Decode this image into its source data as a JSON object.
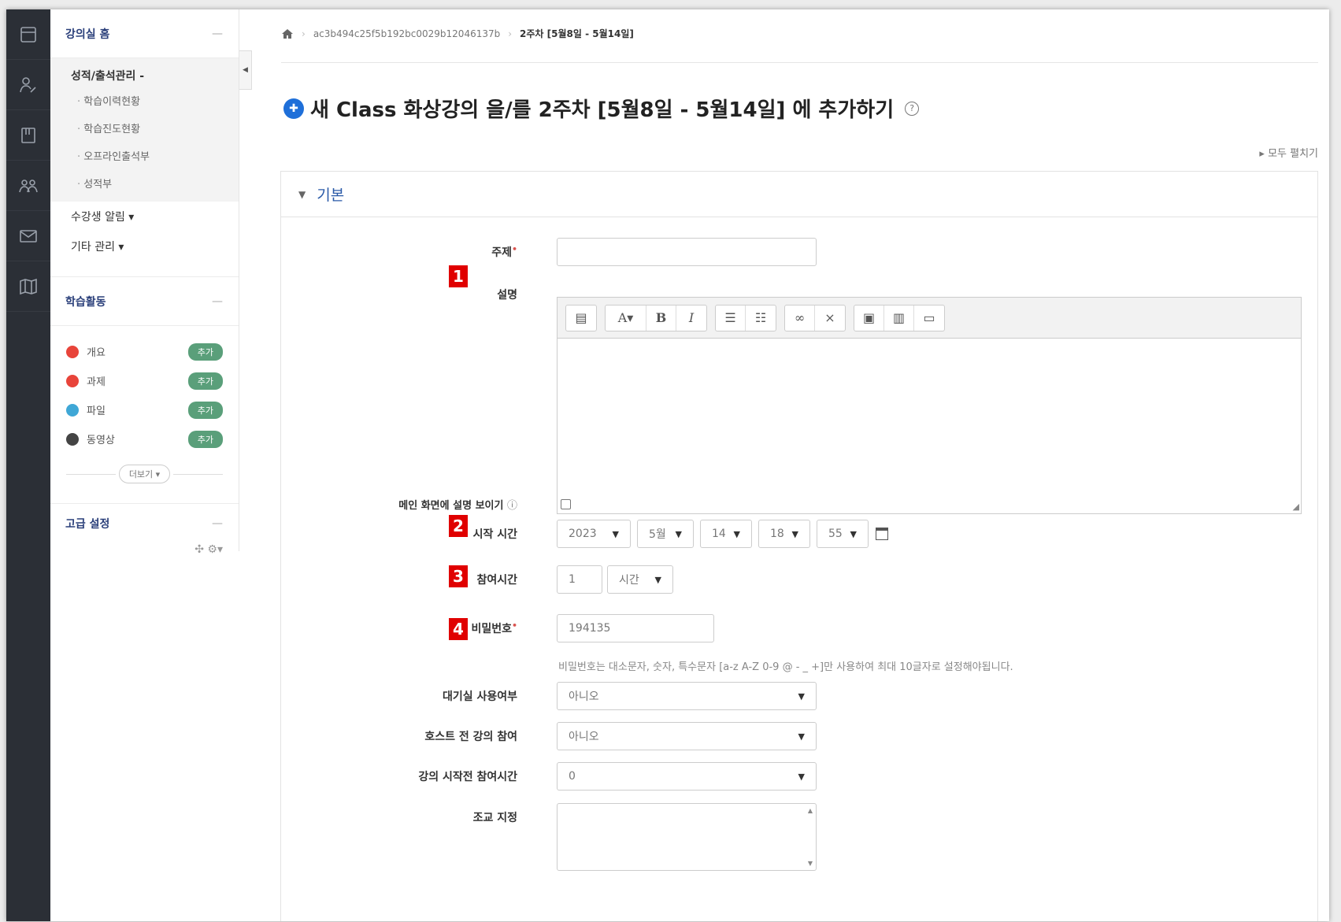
{
  "rail": {
    "icons": [
      "dashboard-icon",
      "people-icon",
      "book-icon",
      "group-icon",
      "mail-icon",
      "map-icon"
    ]
  },
  "sidebar": {
    "course_home": "강의실 홈",
    "grades_group": "성적/출석관리 -",
    "grades_items": [
      "학습이력현황",
      "학습진도현황",
      "오프라인출석부",
      "성적부"
    ],
    "student_notice": "수강생 알림 ▾",
    "other_admin": "기타 관리 ▾",
    "activities_title": "학습활동",
    "activities": [
      {
        "name": "개요",
        "color": "#e8443a",
        "add": "추가"
      },
      {
        "name": "과제",
        "color": "#e8443a",
        "add": "추가"
      },
      {
        "name": "파일",
        "color": "#3fa7d6",
        "add": "추가"
      },
      {
        "name": "동영상",
        "color": "#444444",
        "add": "추가"
      }
    ],
    "more": "더보기 ▾",
    "advanced_title": "고급 설정",
    "advanced_tools": "✣ ⚙▾",
    "dash": "—"
  },
  "breadcrumb": {
    "home_icon": "home-icon",
    "course": "ac3b494c25f5b192bc0029b12046137b",
    "current": "2주차 [5월8일 - 5월14일]"
  },
  "page_title": "새 Class 화상강의 을/를 2주차 [5월8일 - 5월14일] 에 추가하기",
  "expand_all": "모두 펼치기",
  "section_title": "기본",
  "form": {
    "subject_label": "주제",
    "required_mark": "•",
    "desc_label": "설명",
    "show_desc_label": "메인 화면에 설명 보이기",
    "start_label": "시작 시간",
    "start": {
      "year": "2023",
      "month": "5월",
      "day": "14",
      "hour": "18",
      "minute": "55"
    },
    "duration_label": "참여시간",
    "duration_value": "1",
    "duration_unit": "시간",
    "password_label": "비밀번호",
    "password_value": "194135",
    "password_hint": "비밀번호는 대소문자, 숫자, 특수문자 [a-z A-Z 0-9 @ - _ +]만 사용하여 최대 10글자로 설정해야됩니다.",
    "waiting_label": "대기실 사용여부",
    "waiting_value": "아니오",
    "join_before_host_label": "호스트 전 강의 참여",
    "join_before_host_value": "아니오",
    "early_join_label": "강의 시작전 참여시간",
    "early_join_value": "0",
    "alt_host_label": "조교 지정"
  },
  "badges": [
    "1",
    "2",
    "3",
    "4"
  ]
}
